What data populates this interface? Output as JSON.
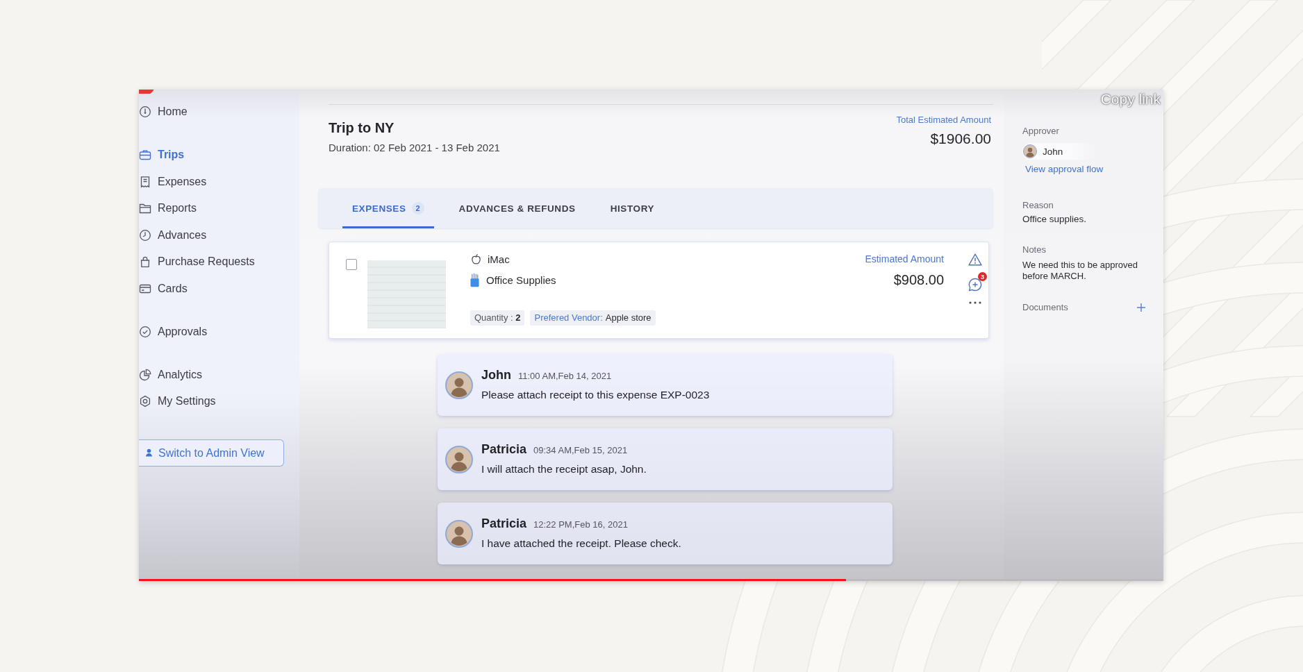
{
  "video": {
    "overlay_text": "Copy link",
    "progress": {
      "level": 0.69
    }
  },
  "sidebar": {
    "groups": [
      {
        "items": [
          {
            "label": "Home",
            "selected": false
          }
        ]
      },
      {
        "items": [
          {
            "label": "Trips",
            "selected": true
          },
          {
            "label": "Expenses",
            "selected": false
          },
          {
            "label": "Reports",
            "selected": false
          },
          {
            "label": "Advances",
            "selected": false
          },
          {
            "label": "Purchase Requests",
            "selected": false
          },
          {
            "label": "Cards",
            "selected": false
          }
        ]
      },
      {
        "items": [
          {
            "label": "Approvals",
            "selected": false
          }
        ]
      },
      {
        "items": [
          {
            "label": "Analytics",
            "selected": false
          },
          {
            "label": "My Settings",
            "selected": false
          }
        ]
      }
    ],
    "admin_button": "Switch to Admin View"
  },
  "trip": {
    "title": "Trip to NY",
    "duration": "Duration: 02 Feb 2021 - 13 Feb 2021",
    "total_label": "Total Estimated Amount",
    "total_amount": "$1906.00"
  },
  "tabs": [
    {
      "label": "EXPENSES",
      "count": "2",
      "selected": true
    },
    {
      "label": "ADVANCES & REFUNDS",
      "selected": false
    },
    {
      "label": "HISTORY",
      "selected": false
    }
  ],
  "expense": {
    "checked": false,
    "item": "iMac",
    "category": "Office Supplies",
    "quantity": "Quantity : **2**",
    "vendor_label": "Prefered Vendor:",
    "vendor": "Apple store",
    "amount_label": "Estimated Amount",
    "amount": "$908.00",
    "comment_count": "3"
  },
  "comments": [
    {
      "author": "John",
      "time": "11:00 AM,Feb 14, 2021",
      "message": "Please attach receipt to this expense EXP-0023"
    },
    {
      "author": "Patricia",
      "time": "09:34 AM,Feb 15, 2021",
      "message": "I will attach the receipt asap, John."
    },
    {
      "author": "Patricia",
      "time": "12:22 PM,Feb 16, 2021",
      "message": "I have attached the receipt. Please check."
    }
  ],
  "details": {
    "approver_label": "Approver",
    "approver": "John",
    "approval_link": "View approval flow",
    "reason_label": "Reason",
    "reason": "Office supplies.",
    "notes_label": "Notes",
    "notes": "We need this to be approved before MARCH.",
    "documents_label": "Documents"
  }
}
